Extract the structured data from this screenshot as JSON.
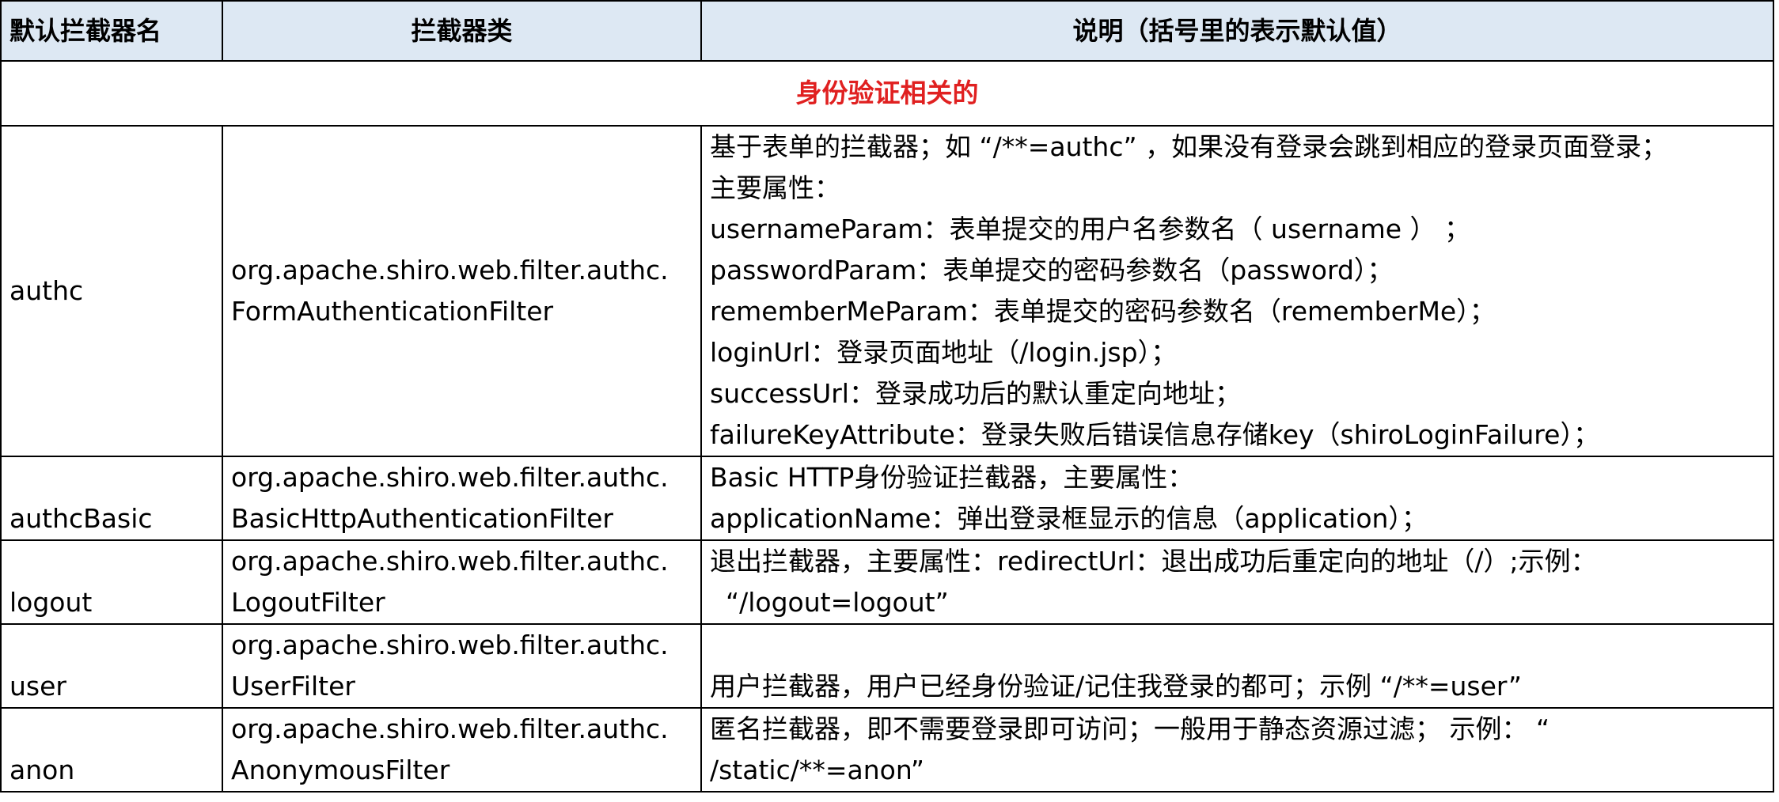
{
  "headers": {
    "name": "默认拦截器名",
    "class": "拦截器类",
    "desc": "说明（括号里的表示默认值）"
  },
  "section_title": "身份验证相关的",
  "rows": [
    {
      "name": "authc",
      "class_lines": [
        "org.apache.shiro.web.filter.authc.",
        "FormAuthenticationFilter"
      ],
      "desc_lines": [
        "基于表单的拦截器；如 “/**=authc” ，如果没有登录会跳到相应的登录页面登录；",
        "主要属性：",
        "usernameParam：表单提交的用户名参数名（ username ） ；",
        "passwordParam：表单提交的密码参数名（password）；",
        "rememberMeParam：表单提交的密码参数名（rememberMe）；",
        "loginUrl：登录页面地址（/login.jsp）；",
        "successUrl：登录成功后的默认重定向地址；",
        "failureKeyAttribute：登录失败后错误信息存储key（shiroLoginFailure）；"
      ]
    },
    {
      "name": "authcBasic",
      "class_lines": [
        "org.apache.shiro.web.filter.authc.",
        "BasicHttpAuthenticationFilter"
      ],
      "desc_lines": [
        "Basic HTTP身份验证拦截器，主要属性：",
        "applicationName：弹出登录框显示的信息（application）；"
      ]
    },
    {
      "name": "logout",
      "class_lines": [
        "org.apache.shiro.web.filter.authc.",
        "LogoutFilter"
      ],
      "desc_lines": [
        "退出拦截器，主要属性：redirectUrl：退出成功后重定向的地址（/）;示例：",
        " “/logout=logout”"
      ]
    },
    {
      "name": "user",
      "class_lines": [
        "org.apache.shiro.web.filter.authc.",
        "UserFilter"
      ],
      "desc_lines": [
        "",
        "用户拦截器，用户已经身份验证/记住我登录的都可；示例 “/**=user”"
      ]
    },
    {
      "name": "anon",
      "class_lines": [
        "org.apache.shiro.web.filter.authc.",
        "AnonymousFilter"
      ],
      "desc_lines": [
        "匿名拦截器，即不需要登录即可访问；一般用于静态资源过滤； 示例： “",
        "/static/**=anon”"
      ]
    }
  ]
}
